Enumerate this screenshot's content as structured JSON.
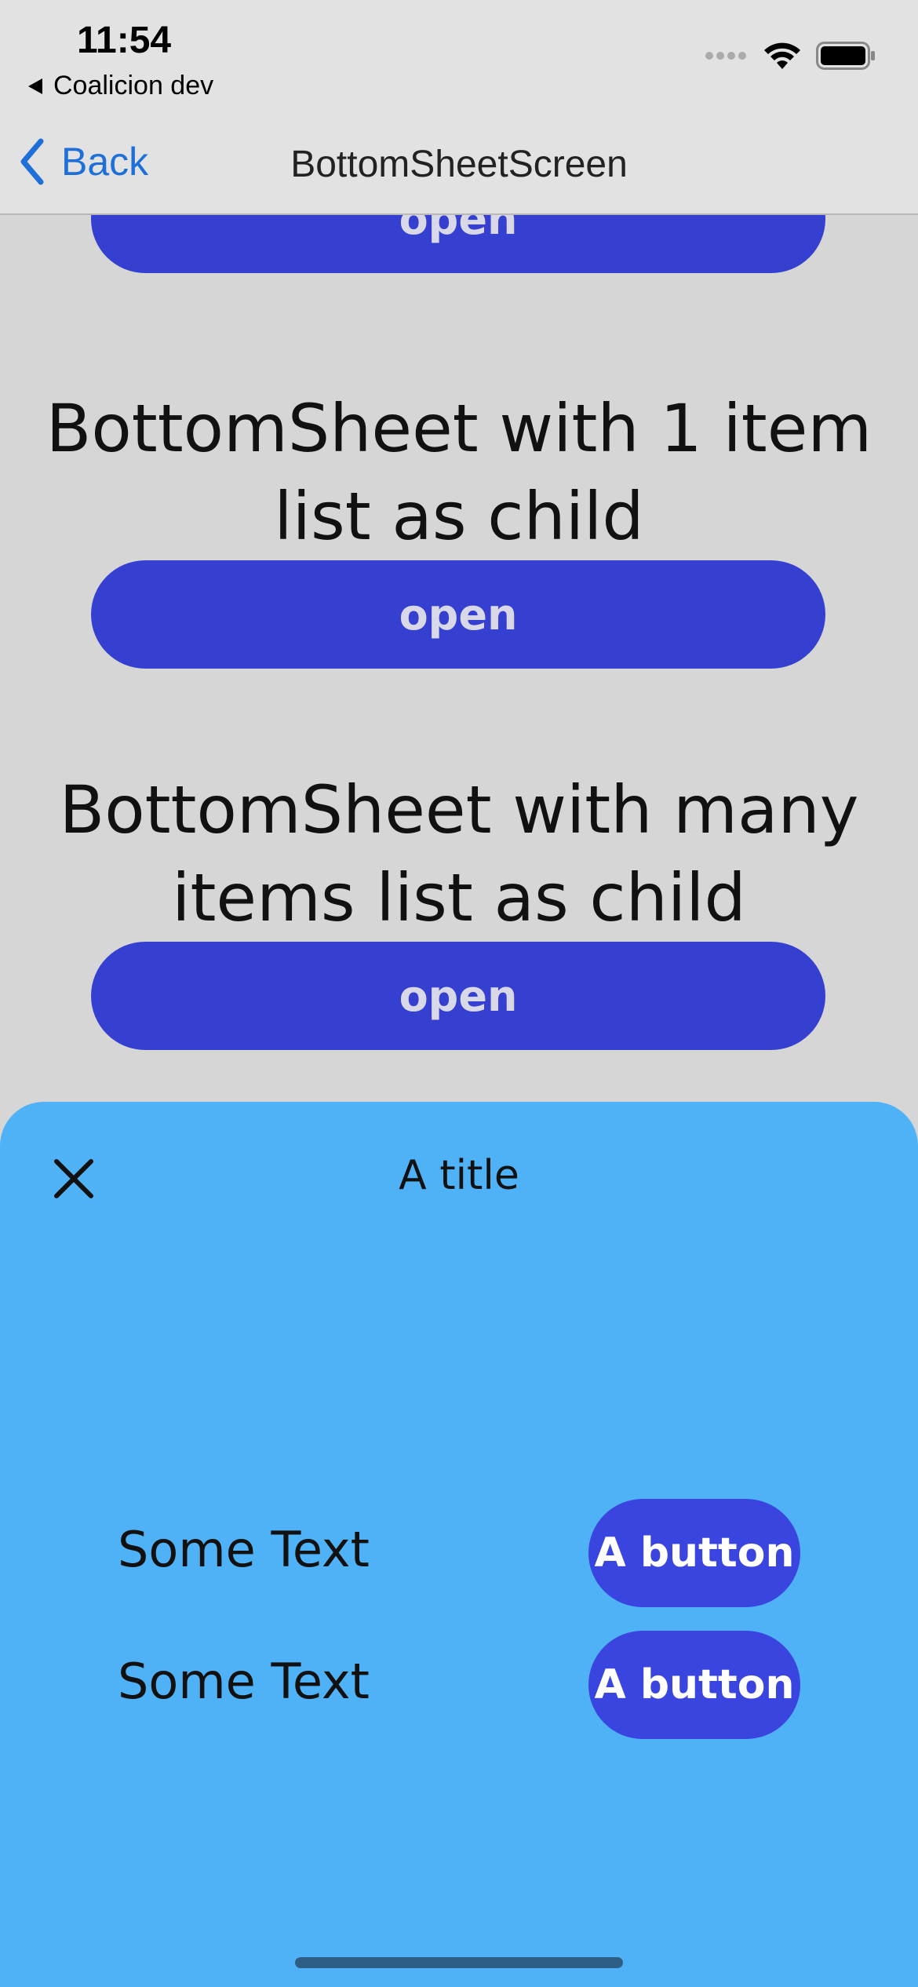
{
  "status_bar": {
    "time": "11:54",
    "back_app": "Coalicion dev"
  },
  "nav": {
    "back_label": "Back",
    "title": "BottomSheetScreen"
  },
  "content": {
    "top_button_label": "open",
    "sections": [
      {
        "title_line1": "BottomSheet with 1 item",
        "title_line2": "list as child",
        "button_label": "open"
      },
      {
        "title_line1": "BottomSheet with many",
        "title_line2": "items list as child",
        "button_label": "open"
      }
    ]
  },
  "sheet": {
    "title": "A title",
    "rows": [
      {
        "text": "Some Text",
        "button_label": "A button"
      },
      {
        "text": "Some Text",
        "button_label": "A button"
      }
    ]
  },
  "colors": {
    "primary_button": "#3640d0",
    "sheet_background": "#50b2f6",
    "sheet_button": "#3a45e0",
    "ios_link": "#1f6fd8"
  }
}
